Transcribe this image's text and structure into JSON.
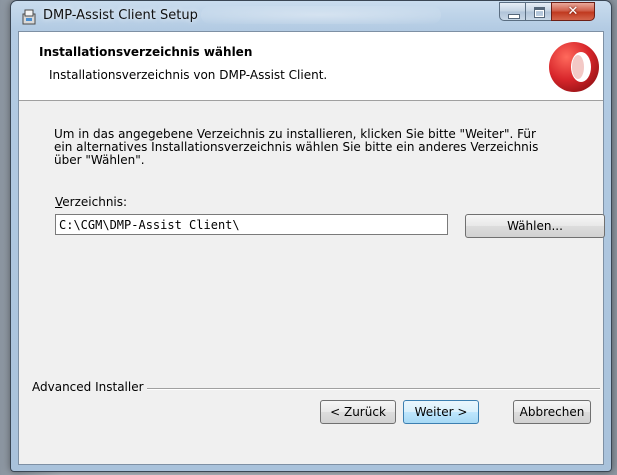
{
  "window": {
    "title": "DMP-Assist Client Setup",
    "controls": [
      "minimize",
      "maximize",
      "close"
    ]
  },
  "banner": {
    "title": "Installationsverzeichnis wählen",
    "subtitle": "Installationsverzeichnis von DMP-Assist Client."
  },
  "body": {
    "description": "Um in das angegebene Verzeichnis zu installieren, klicken Sie bitte \"Weiter\". Für ein alternatives Installationsverzeichnis wählen Sie bitte ein anderes Verzeichnis über \"Wählen\".",
    "directory_label": "Verzeichnis:",
    "directory_value": "C:\\CGM\\DMP-Assist Client\\",
    "choose_label": "Wählen..."
  },
  "footer": {
    "brand": "Advanced Installer",
    "back_label": "< Zurück",
    "next_label": "Weiter >",
    "cancel_label": "Abbrechen"
  },
  "colors": {
    "logo_red": "#d8262b",
    "focus_button_border": "#3c7fb1"
  }
}
